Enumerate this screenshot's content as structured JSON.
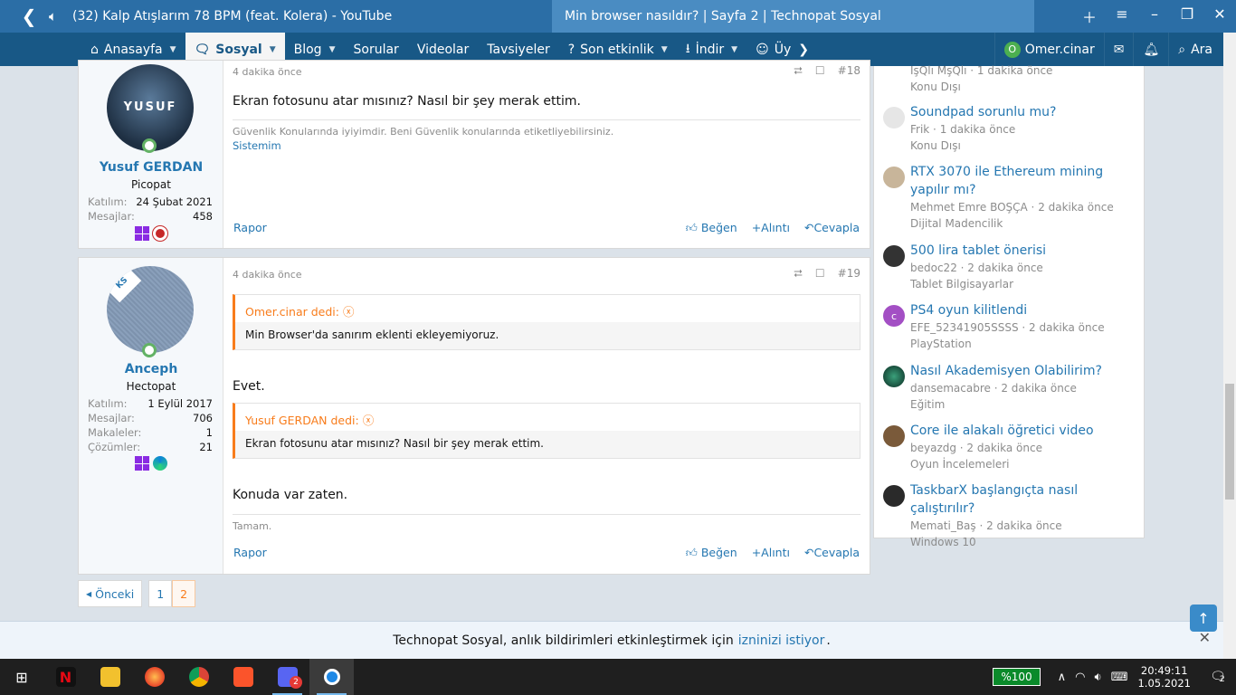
{
  "browser": {
    "tabs": [
      {
        "label": "(32) Kalp Atışlarım 78 BPM (feat. Kolera) - YouTube",
        "icon": "speaker-icon"
      },
      {
        "label": "Min browser nasıldır? | Sayfa 2 | Technopat Sosyal"
      }
    ]
  },
  "nav": {
    "items": [
      "Anasayfa",
      "Sosyal",
      "Blog",
      "Sorular",
      "Videolar",
      "Tavsiyeler",
      "Son etkinlik",
      "İndir",
      "Üy"
    ],
    "user": "Omer.cinar",
    "user_initial": "O",
    "search": "Ara"
  },
  "posts": [
    {
      "date": "4 dakika önce",
      "number": "#18",
      "avatar_text": "YUSUF",
      "username": "Yusuf GERDAN",
      "user_title": "Picopat",
      "stats": [
        {
          "k": "Katılım:",
          "v": "24 Şubat 2021"
        },
        {
          "k": "Mesajlar:",
          "v": "458"
        }
      ],
      "text": "Ekran fotosunu atar mısınız? Nasıl bir şey merak ettim.",
      "signature": "Güvenlik Konularında iyiyimdir. Beni Güvenlik konularında etiketliyebilirsiniz.",
      "signature_link": "Sistemim"
    },
    {
      "date": "4 dakika önce",
      "number": "#19",
      "avatar_text": "KS",
      "username": "Anceph",
      "user_title": "Hectopat",
      "stats": [
        {
          "k": "Katılım:",
          "v": "1 Eylül 2017"
        },
        {
          "k": "Mesajlar:",
          "v": "706"
        },
        {
          "k": "Makaleler:",
          "v": "1"
        },
        {
          "k": "Çözümler:",
          "v": "21"
        }
      ],
      "quote1_author": "Omer.cinar dedi:",
      "quote1_text": "Min Browser'da sanırım eklenti ekleyemiyoruz.",
      "reply1": "Evet.",
      "quote2_author": "Yusuf GERDAN dedi:",
      "quote2_text": "Ekran fotosunu atar mısınız? Nasıl bir şey merak ettim.",
      "reply2": "Konuda var zaten.",
      "signature": "Tamam."
    }
  ],
  "actions": {
    "report": "Rapor",
    "like": "Beğen",
    "quote": "Alıntı",
    "reply": "Cevapla"
  },
  "sidebar": [
    {
      "title": "",
      "meta": "IşQlı MşQlı · 1 dakika önce",
      "forum": "Konu Dışı",
      "color": "#999999"
    },
    {
      "title": "Soundpad sorunlu mu?",
      "meta": "Frik · 1 dakika önce",
      "forum": "Konu Dışı",
      "color": "#dddddd"
    },
    {
      "title": "RTX 3070 ile Ethereum mining yapılır mı?",
      "meta": "Mehmet Emre BOŞÇA · 2 dakika önce",
      "forum": "Dijital Madencilik",
      "color": "#c8b59a"
    },
    {
      "title": "500 lira tablet önerisi",
      "meta": "bedoc22 · 2 dakika önce",
      "forum": "Tablet Bilgisayarlar",
      "color": "#333333"
    },
    {
      "title": "PS4 oyun kilitlendi",
      "meta": "EFE_52341905SSSS · 2 dakika önce",
      "forum": "PlayStation",
      "color": "#a34fc4",
      "initial": "c"
    },
    {
      "title": "Nasıl Akademisyen Olabilirim?",
      "meta": "dansemacabre · 2 dakika önce",
      "forum": "Eğitim",
      "color": "#1f5f4a"
    },
    {
      "title": "Core ile alakalı öğretici video",
      "meta": "beyazdg · 2 dakika önce",
      "forum": "Oyun İncelemeleri",
      "color": "#7a5a3a"
    },
    {
      "title": "TaskbarX başlangıçta nasıl çalıştırılır?",
      "meta": "Memati_Baş · 2 dakika önce",
      "forum": "Windows 10",
      "color": "#2a2a2a"
    }
  ],
  "pager": {
    "prev": "Önceki",
    "pages": [
      "1",
      "2"
    ]
  },
  "notification": {
    "text": "Technopat Sosyal, anlık bildirimleri etkinleştirmek için",
    "link": "izninizi istiyor",
    "suffix": "."
  },
  "taskbar": {
    "battery": "%100",
    "time": "20:49:11",
    "date": "1.05.2021",
    "notif_count": "2",
    "discord_badge": "2"
  },
  "colors": {
    "accent": "#185886",
    "link": "#2577b1",
    "quote": "#f87c1b"
  }
}
